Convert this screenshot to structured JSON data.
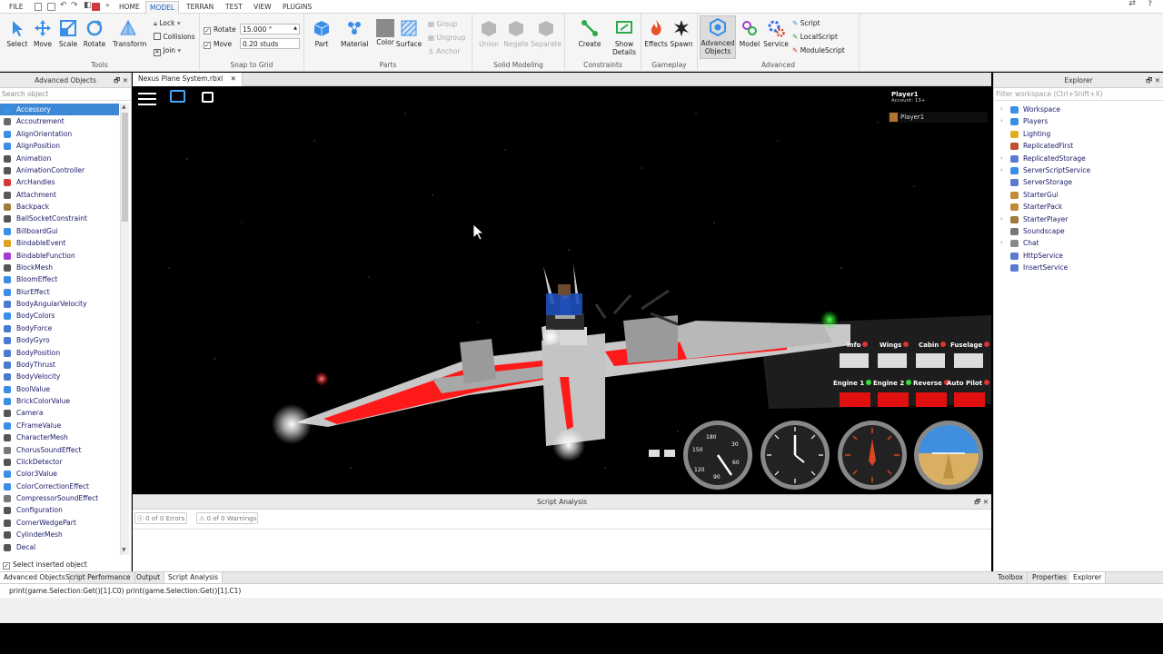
{
  "menu_tabs": [
    "FILE",
    "HOME",
    "MODEL",
    "TERRAN",
    "TEST",
    "VIEW",
    "PLUGINS"
  ],
  "active_tab": "MODEL",
  "ribbon": {
    "tools": {
      "label": "Tools",
      "buttons": [
        "Select",
        "Move",
        "Scale",
        "Rotate",
        "Transform"
      ],
      "lock": "Lock",
      "collisions": "Collisions",
      "join": "Join"
    },
    "snap": {
      "label": "Snap to Grid",
      "rotate": "Rotate",
      "move": "Move",
      "rotate_value": "15.000 °",
      "move_value": "0.20 studs"
    },
    "parts": {
      "label": "Parts",
      "buttons": [
        "Part",
        "Material",
        "Color",
        "Surface"
      ],
      "group": "Group",
      "ungroup": "Ungroup",
      "anchor": "Anchor"
    },
    "solid": {
      "label": "Solid Modeling",
      "buttons": [
        "Union",
        "Negate",
        "Separate"
      ]
    },
    "constraints": {
      "label": "Constraints",
      "create": "Create",
      "show": "Show",
      "details": "Details"
    },
    "gameplay": {
      "label": "Gameplay",
      "buttons": [
        "Effects",
        "Spawn"
      ]
    },
    "advanced": {
      "label": "Advanced",
      "adv1": "Advanced",
      "adv2": "Objects",
      "model": "Model",
      "service": "Service",
      "scripts": [
        "Script",
        "LocalScript",
        "ModuleScript"
      ]
    }
  },
  "left_panel": {
    "title": "Advanced Objects",
    "search_placeholder": "Search object",
    "items": [
      "Accessory",
      "Accoutrement",
      "AlignOrientation",
      "AlignPosition",
      "Animation",
      "AnimationController",
      "ArcHandles",
      "Attachment",
      "Backpack",
      "BallSocketConstraint",
      "BillboardGui",
      "BindableEvent",
      "BindableFunction",
      "BlockMesh",
      "BloomEffect",
      "BlurEffect",
      "BodyAngularVelocity",
      "BodyColors",
      "BodyForce",
      "BodyGyro",
      "BodyPosition",
      "BodyThrust",
      "BodyVelocity",
      "BoolValue",
      "BrickColorValue",
      "Camera",
      "CFrameValue",
      "CharacterMesh",
      "ChorusSoundEffect",
      "ClickDetector",
      "Color3Value",
      "ColorCorrectionEffect",
      "CompressorSoundEffect",
      "Configuration",
      "CornerWedgePart",
      "CylinderMesh",
      "Decal"
    ],
    "selected_index": 0,
    "select_inserted": "Select inserted object"
  },
  "doc_tab": "Nexus Plane System.rbxl",
  "player": {
    "name": "Player1",
    "account": "Account: 13+",
    "list_name": "Player1"
  },
  "hud": {
    "top_labels": [
      "Info",
      "Wings",
      "Cabin",
      "Fuselage"
    ],
    "bottom_labels": [
      "Engine 1",
      "Engine 2",
      "Reverse",
      "Auto Pilot"
    ],
    "speed_ticks": [
      "180",
      "150",
      "30",
      "60",
      "90",
      "120"
    ]
  },
  "script_analysis": {
    "title": "Script Analysis",
    "errors": "0 of 0 Errors",
    "warnings": "0 of 0 Warnings"
  },
  "explorer": {
    "title": "Explorer",
    "filter_placeholder": "Filter workspace (Ctrl+Shift+X)",
    "items": [
      {
        "name": "Workspace",
        "expand": true
      },
      {
        "name": "Players",
        "expand": true
      },
      {
        "name": "Lighting",
        "expand": false
      },
      {
        "name": "ReplicatedFirst",
        "expand": false
      },
      {
        "name": "ReplicatedStorage",
        "expand": true
      },
      {
        "name": "ServerScriptService",
        "expand": true
      },
      {
        "name": "ServerStorage",
        "expand": false
      },
      {
        "name": "StarterGui",
        "expand": false
      },
      {
        "name": "StarterPack",
        "expand": false
      },
      {
        "name": "StarterPlayer",
        "expand": true
      },
      {
        "name": "Soundscape",
        "expand": false
      },
      {
        "name": "Chat",
        "expand": true
      },
      {
        "name": "HttpService",
        "expand": false
      },
      {
        "name": "InsertService",
        "expand": false
      }
    ]
  },
  "bottom_tabs_left": [
    "Advanced Objects",
    "Script Performance",
    "Output",
    "Script Analysis"
  ],
  "bottom_tabs_right": [
    "Toolbox",
    "Properties",
    "Explorer"
  ],
  "command": "print(game.Selection:Get()[1].C0) print(game.Selection:Get()[1].C1)"
}
